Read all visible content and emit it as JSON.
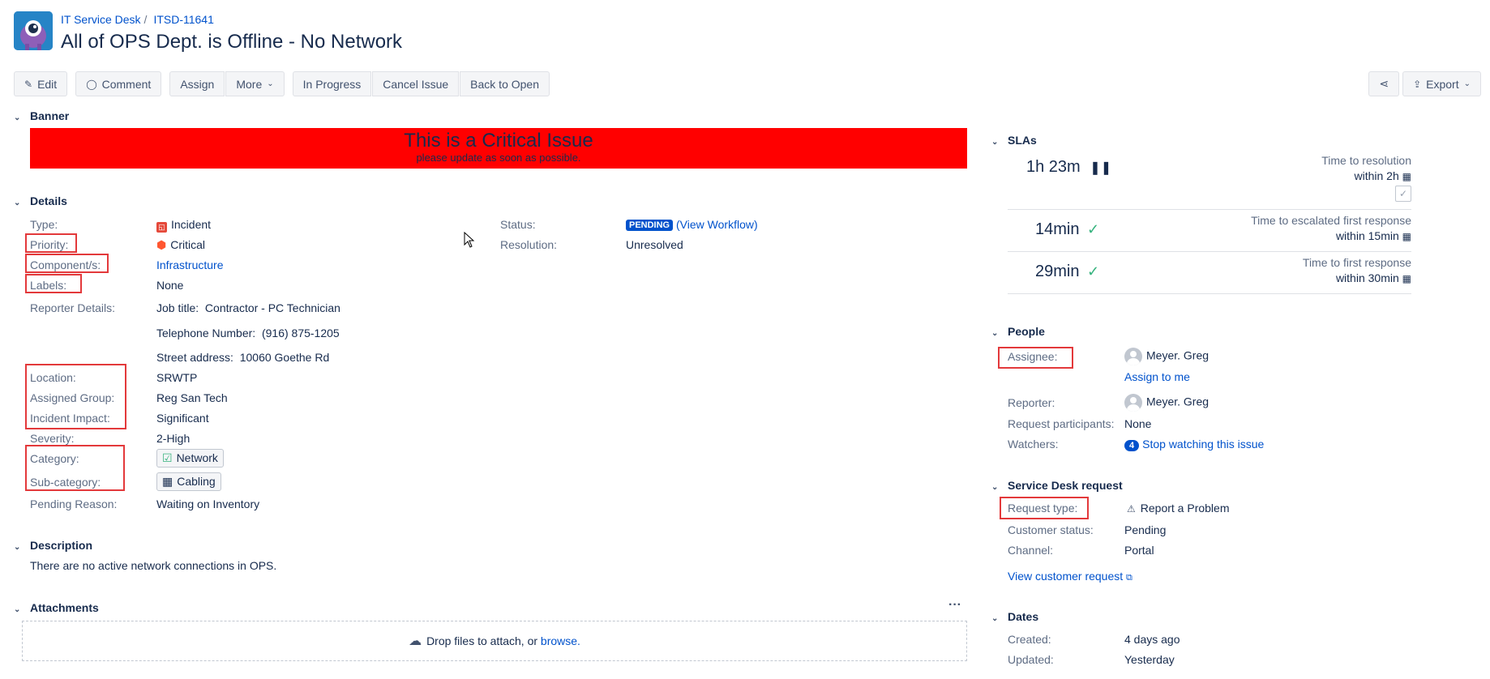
{
  "header": {
    "breadcrumb": [
      "IT Service Desk",
      "ITSD-11641"
    ],
    "title": "All of OPS Dept. is Offline - No Network"
  },
  "toolbar": {
    "edit": "Edit",
    "comment": "Comment",
    "assign": "Assign",
    "more": "More",
    "in_progress": "In Progress",
    "cancel_issue": "Cancel Issue",
    "back_to_open": "Back to Open",
    "export": "Export"
  },
  "banner": {
    "heading": "Banner",
    "main": "This is a Critical Issue",
    "sub": "please update as soon as possible.",
    "color": "#ff0000"
  },
  "details": {
    "heading": "Details",
    "type_label": "Type:",
    "type_value": "Incident",
    "priority_label": "Priority:",
    "priority_value": "Critical",
    "components_label": "Component/s:",
    "components_value": "Infrastructure",
    "labels_label": "Labels:",
    "labels_value": "None",
    "reporter_details_label": "Reporter Details:",
    "job_title_key": "Job title:",
    "job_title_value": "Contractor - PC Technician",
    "phone_key": "Telephone Number:",
    "phone_value": "(916) 875-1205",
    "street_key": "Street address:",
    "street_value": "10060 Goethe Rd",
    "location_label": "Location:",
    "location_value": "SRWTP",
    "assigned_group_label": "Assigned Group:",
    "assigned_group_value": "Reg San Tech",
    "impact_label": "Incident Impact:",
    "impact_value": "Significant",
    "severity_label": "Severity:",
    "severity_value": "2-High",
    "category_label": "Category:",
    "category_value": "Network",
    "subcategory_label": "Sub-category:",
    "subcategory_value": "Cabling",
    "pending_reason_label": "Pending Reason:",
    "pending_reason_value": "Waiting on Inventory",
    "status_label": "Status:",
    "status_value": "PENDING",
    "view_workflow": "(View Workflow)",
    "resolution_label": "Resolution:",
    "resolution_value": "Unresolved"
  },
  "description": {
    "heading": "Description",
    "text": "There are no active network connections in OPS."
  },
  "attachments": {
    "heading": "Attachments",
    "drop_text": "Drop files to attach, or",
    "browse": "browse."
  },
  "slas": {
    "heading": "SLAs",
    "items": [
      {
        "time": "1h 23m",
        "name": "Time to resolution",
        "goal": "within 2h"
      },
      {
        "time": "14min",
        "name": "Time to escalated first response",
        "goal": "within 15min"
      },
      {
        "time": "29min",
        "name": "Time to first response",
        "goal": "within 30min"
      }
    ]
  },
  "people": {
    "heading": "People",
    "assignee_label": "Assignee:",
    "assignee_value": "Meyer. Greg",
    "assign_to_me": "Assign to me",
    "reporter_label": "Reporter:",
    "reporter_value": "Meyer. Greg",
    "participants_label": "Request participants:",
    "participants_value": "None",
    "watchers_label": "Watchers:",
    "watchers_count": "4",
    "watchers_link": "Stop watching this issue"
  },
  "service_desk": {
    "heading": "Service Desk request",
    "request_type_label": "Request type:",
    "request_type_value": "Report a Problem",
    "customer_status_label": "Customer status:",
    "customer_status_value": "Pending",
    "channel_label": "Channel:",
    "channel_value": "Portal",
    "view_customer_request": "View customer request"
  },
  "dates": {
    "heading": "Dates",
    "created_label": "Created:",
    "created_value": "4 days ago",
    "updated_label": "Updated:",
    "updated_value": "Yesterday"
  },
  "colors": {
    "link": "#0052cc",
    "highlight": "#e3393b",
    "check": "#36b37e"
  }
}
